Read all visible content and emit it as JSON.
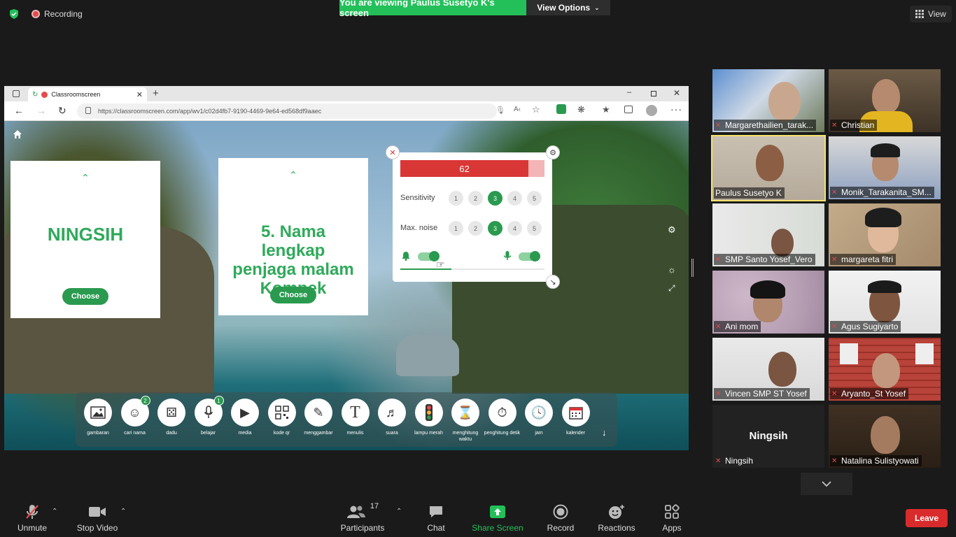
{
  "topbar": {
    "recording_label": "Recording",
    "viewing_banner": "You are viewing Paulus Susetyo K's screen",
    "view_options_label": "View Options",
    "view_label": "View"
  },
  "browser": {
    "tab_title": "Classroomscreen",
    "url": "https://classroomscreen.com/app/wv1/c02d4fb7-9190-4469-9e64-ed568df9aaec"
  },
  "classroom": {
    "card1": {
      "text": "NINGSIH",
      "button": "Choose"
    },
    "card2": {
      "text": "5. Nama lengkap penjaga malam Kompek",
      "button": "Choose"
    },
    "noise": {
      "level": 62,
      "level_fraction": 0.89,
      "sensitivity_label": "Sensitivity",
      "max_noise_label": "Max. noise",
      "options": [
        "1",
        "2",
        "3",
        "4",
        "5"
      ],
      "sensitivity_selected": 3,
      "max_noise_selected": 3
    },
    "tools": [
      {
        "label": "gambaran",
        "icon": "image-icon"
      },
      {
        "label": "cari nama",
        "icon": "name-picker-icon",
        "badge": "2"
      },
      {
        "label": "dadu",
        "icon": "dice-icon"
      },
      {
        "label": "belajar",
        "icon": "microphone-icon",
        "badge": "1"
      },
      {
        "label": "media",
        "icon": "media-icon"
      },
      {
        "label": "kode qr",
        "icon": "qr-code-icon"
      },
      {
        "label": "menggambar",
        "icon": "pencil-icon"
      },
      {
        "label": "menulis",
        "icon": "text-icon"
      },
      {
        "label": "suara",
        "icon": "sound-icon"
      },
      {
        "label": "lampu merah",
        "icon": "traffic-light-icon"
      },
      {
        "label": "menghitung waktu",
        "icon": "hourglass-icon"
      },
      {
        "label": "penghitung detik",
        "icon": "stopwatch-icon"
      },
      {
        "label": "jam",
        "icon": "clock-icon"
      },
      {
        "label": "kalender",
        "icon": "calendar-icon"
      }
    ]
  },
  "gallery": [
    {
      "name": "Margarethailien_tarak...",
      "muted": true
    },
    {
      "name": "Christian",
      "muted": true
    },
    {
      "name": "Paulus Susetyo K",
      "muted": false,
      "active": true
    },
    {
      "name": "Monik_Tarakanita_SM...",
      "muted": true
    },
    {
      "name": "SMP Santo Yosef_Vero",
      "muted": true
    },
    {
      "name": "margareta fitri",
      "muted": true
    },
    {
      "name": "Ani mom",
      "muted": true
    },
    {
      "name": "Agus Sugiyarto",
      "muted": true
    },
    {
      "name": "Vincen SMP ST Yosef",
      "muted": true
    },
    {
      "name": "Aryanto_St Yosef",
      "muted": true
    },
    {
      "name": "Ningsih",
      "muted": true,
      "placeholder_name": "Ningsih"
    },
    {
      "name": "Natalina Sulistyowati",
      "muted": true
    }
  ],
  "controls": {
    "unmute": "Unmute",
    "stop_video": "Stop Video",
    "participants": "Participants",
    "participants_count": "17",
    "chat": "Chat",
    "share_screen": "Share Screen",
    "record": "Record",
    "reactions": "Reactions",
    "apps": "Apps",
    "leave": "Leave"
  },
  "colors": {
    "zoom_green": "#23c05a",
    "classroom_green": "#2a9a4f",
    "meter_red": "#d93636",
    "leave_red": "#d92b2b",
    "active_speaker": "#f3e26b"
  }
}
